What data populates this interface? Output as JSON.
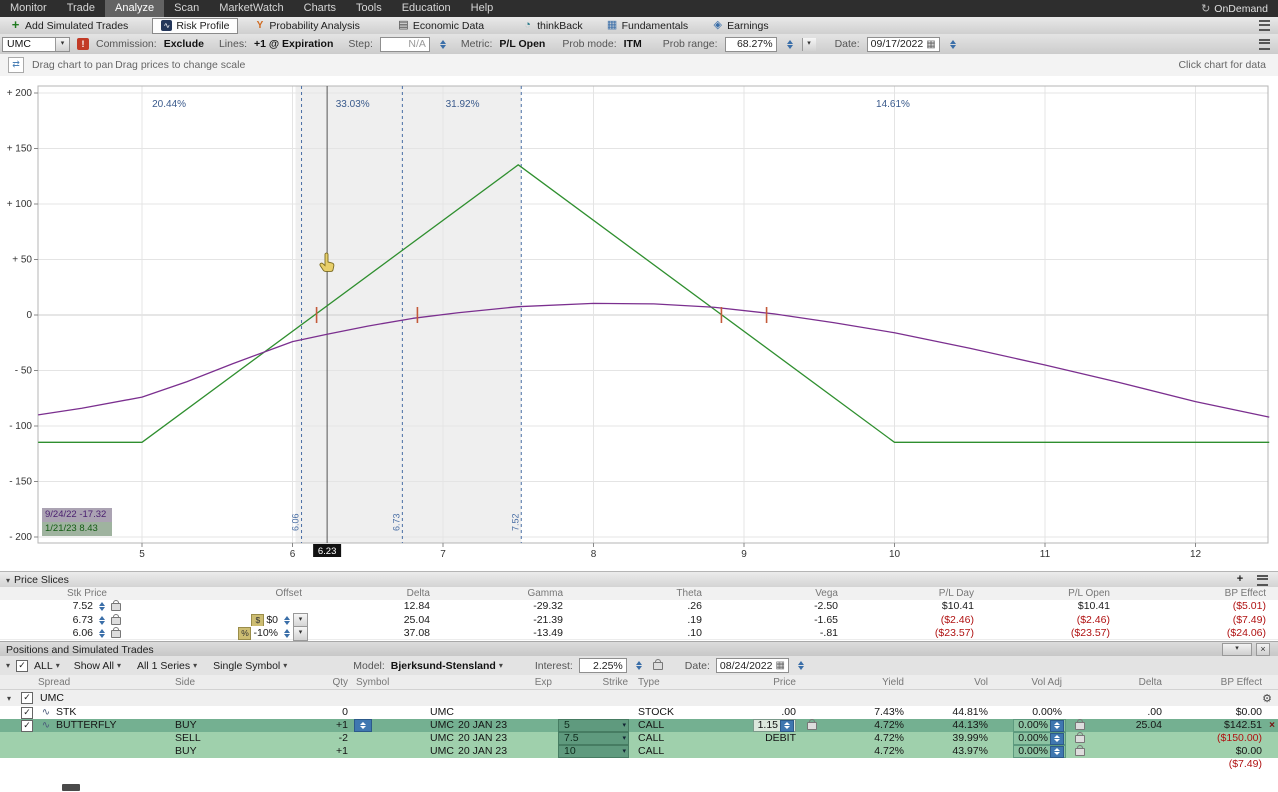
{
  "menu_bar": {
    "items": [
      "Monitor",
      "Trade",
      "Analyze",
      "Scan",
      "MarketWatch",
      "Charts",
      "Tools",
      "Education",
      "Help"
    ],
    "ondemand_label": "OnDemand"
  },
  "toolbar": {
    "add_trades": "Add Simulated Trades",
    "risk_profile": "Risk Profile",
    "probability_analysis": "Probability Analysis",
    "economic_data": "Economic Data",
    "think_back": "thinkBack",
    "fundamentals": "Fundamentals",
    "earnings": "Earnings"
  },
  "settings": {
    "symbol": "UMC",
    "commission_label": "Commission:",
    "commission_value": "Exclude",
    "lines_label": "Lines:",
    "lines_value": "+1 @ Expiration",
    "step_label": "Step:",
    "step_value": "N/A",
    "metric_label": "Metric:",
    "metric_value": "P/L Open",
    "prob_mode_label": "Prob mode:",
    "prob_mode_value": "ITM",
    "prob_range_label": "Prob range:",
    "prob_range_value": "68.27%",
    "date_label": "Date:",
    "date_value": "09/17/2022"
  },
  "hints": {
    "pan": "Drag chart to pan",
    "scale": "Drag prices to change scale",
    "click": "Click chart for data"
  },
  "chart": {
    "crosshair_label": "6.23",
    "tooltip": {
      "line1": "9/24/22 -17.32",
      "line2": "1/21/23 8.43"
    }
  },
  "chart_data": {
    "type": "line",
    "x_range": [
      4.31,
      12.49
    ],
    "y_range": [
      -200,
      200
    ],
    "y_ticks": [
      {
        "v": 200,
        "label": "+ 200"
      },
      {
        "v": 150,
        "label": "+ 150"
      },
      {
        "v": 100,
        "label": "+ 100"
      },
      {
        "v": 50,
        "label": "+ 50"
      },
      {
        "v": 0,
        "label": "0"
      },
      {
        "v": -50,
        "label": "- 50"
      },
      {
        "v": -100,
        "label": "- 100"
      },
      {
        "v": -150,
        "label": "- 150"
      },
      {
        "v": -200,
        "label": "- 200"
      }
    ],
    "x_ticks": [
      {
        "v": 5,
        "label": "5"
      },
      {
        "v": 6,
        "label": "6"
      },
      {
        "v": 7,
        "label": "7"
      },
      {
        "v": 8,
        "label": "8"
      },
      {
        "v": 9,
        "label": "9"
      },
      {
        "v": 10,
        "label": "10"
      },
      {
        "v": 11,
        "label": "11"
      },
      {
        "v": 12,
        "label": "12"
      }
    ],
    "series": [
      {
        "name": "expiration_pl",
        "color": "#2f8f2f",
        "points": [
          [
            4.31,
            -114.7
          ],
          [
            5.0,
            -114.7
          ],
          [
            7.5,
            135.3
          ],
          [
            10.0,
            -114.7
          ],
          [
            12.49,
            -114.7
          ]
        ]
      },
      {
        "name": "current_pl",
        "color": "#7b2f8f",
        "points": [
          [
            4.31,
            -90
          ],
          [
            4.6,
            -84
          ],
          [
            5.0,
            -74
          ],
          [
            5.3,
            -60
          ],
          [
            5.6,
            -44
          ],
          [
            6.0,
            -24
          ],
          [
            6.23,
            -17.3
          ],
          [
            6.5,
            -10
          ],
          [
            6.8,
            -3
          ],
          [
            7.1,
            2
          ],
          [
            7.5,
            7.5
          ],
          [
            8.0,
            10.5
          ],
          [
            8.4,
            10
          ],
          [
            8.8,
            7
          ],
          [
            9.2,
            1
          ],
          [
            9.6,
            -7
          ],
          [
            10.0,
            -16
          ],
          [
            10.5,
            -30
          ],
          [
            11.0,
            -45
          ],
          [
            11.5,
            -61
          ],
          [
            12.0,
            -78
          ],
          [
            12.49,
            -92
          ]
        ]
      }
    ],
    "slices": [
      {
        "p": 6.06,
        "label": "6.06"
      },
      {
        "p": 6.73,
        "label": "6.73"
      },
      {
        "p": 7.52,
        "label": "7.52"
      }
    ],
    "shaded_region": [
      6.02,
      7.52
    ],
    "current_price": 6.23,
    "breakeven_markers": [
      6.16,
      6.83,
      8.85,
      9.15
    ],
    "prob_labels": [
      {
        "p": 5.18,
        "label": "20.44%"
      },
      {
        "p": 6.4,
        "label": "33.03%"
      },
      {
        "p": 7.13,
        "label": "31.92%"
      },
      {
        "p": 9.99,
        "label": "14.61%"
      }
    ],
    "colors": {
      "slice": "#4a6fa5",
      "region": "rgba(100,100,100,0.10)",
      "marker": "#c45a3a",
      "grid": "#e4e4e4",
      "axis_text": "#333333",
      "prob_text": "#3a5a8c"
    }
  },
  "price_slices": {
    "title": "Price Slices",
    "columns": [
      "Stk Price",
      "Offset",
      "Delta",
      "Gamma",
      "Theta",
      "Vega",
      "P/L Day",
      "P/L Open",
      "BP Effect"
    ],
    "rows": [
      {
        "stk_price": "7.52",
        "offset_mode": "",
        "offset": "",
        "delta": "12.84",
        "gamma": "-29.32",
        "theta": ".26",
        "vega": "-2.50",
        "pl_day": "$10.41",
        "pl_open": "$10.41",
        "bp_effect": "($5.01)"
      },
      {
        "stk_price": "6.73",
        "offset_mode": "$",
        "offset": "$0",
        "delta": "25.04",
        "gamma": "-21.39",
        "theta": ".19",
        "vega": "-1.65",
        "pl_day": "($2.46)",
        "pl_open": "($2.46)",
        "bp_effect": "($7.49)"
      },
      {
        "stk_price": "6.06",
        "offset_mode": "%",
        "offset": "-10%",
        "delta": "37.08",
        "gamma": "-13.49",
        "theta": ".10",
        "vega": "-.81",
        "pl_day": "($23.57)",
        "pl_open": "($23.57)",
        "bp_effect": "($24.06)"
      }
    ]
  },
  "positions": {
    "title": "Positions and Simulated Trades",
    "controls": {
      "all_label": "ALL",
      "show_all": "Show All",
      "series": "All 1 Series",
      "symbol_mode": "Single Symbol",
      "model_label": "Model:",
      "model": "Bjerksund-Stensland",
      "interest_label": "Interest:",
      "interest": "2.25%",
      "date_label": "Date:",
      "date": "08/24/2022"
    },
    "columns": [
      "Spread",
      "Side",
      "Qty",
      "Symbol",
      "Exp",
      "Strike",
      "Type",
      "Price",
      "Yield",
      "Vol",
      "Vol Adj",
      "Delta",
      "BP Effect"
    ],
    "group": {
      "symbol": "UMC"
    },
    "rows": [
      {
        "spread": "STK",
        "side": "",
        "qty": "0",
        "symbol": "UMC",
        "exp": "",
        "strike": "",
        "type": "STOCK",
        "price": ".00",
        "yield": "7.43%",
        "vol": "44.81%",
        "vol_adj": "0.00%",
        "delta": ".00",
        "bp_effect": "$0.00"
      },
      {
        "spread": "BUTTERFLY",
        "side": "BUY",
        "qty": "+1",
        "symbol": "UMC",
        "exp": "20 JAN 23",
        "strike": "5",
        "type": "CALL",
        "price": "1.15",
        "yield": "4.72%",
        "vol": "44.13%",
        "vol_adj": "0.00%",
        "delta": "25.04",
        "bp_effect": "$142.51"
      },
      {
        "spread": "",
        "side": "SELL",
        "qty": "-2",
        "symbol": "UMC",
        "exp": "20 JAN 23",
        "strike": "7.5",
        "type": "CALL",
        "price": "DEBIT",
        "yield": "4.72%",
        "vol": "39.99%",
        "vol_adj": "0.00%",
        "delta": "",
        "bp_effect": "($150.00)"
      },
      {
        "spread": "",
        "side": "BUY",
        "qty": "+1",
        "symbol": "UMC",
        "exp": "20 JAN 23",
        "strike": "10",
        "type": "CALL",
        "price": "",
        "yield": "4.72%",
        "vol": "43.97%",
        "vol_adj": "0.00%",
        "delta": "",
        "bp_effect": "$0.00"
      }
    ],
    "total_bp": "($7.49)"
  }
}
